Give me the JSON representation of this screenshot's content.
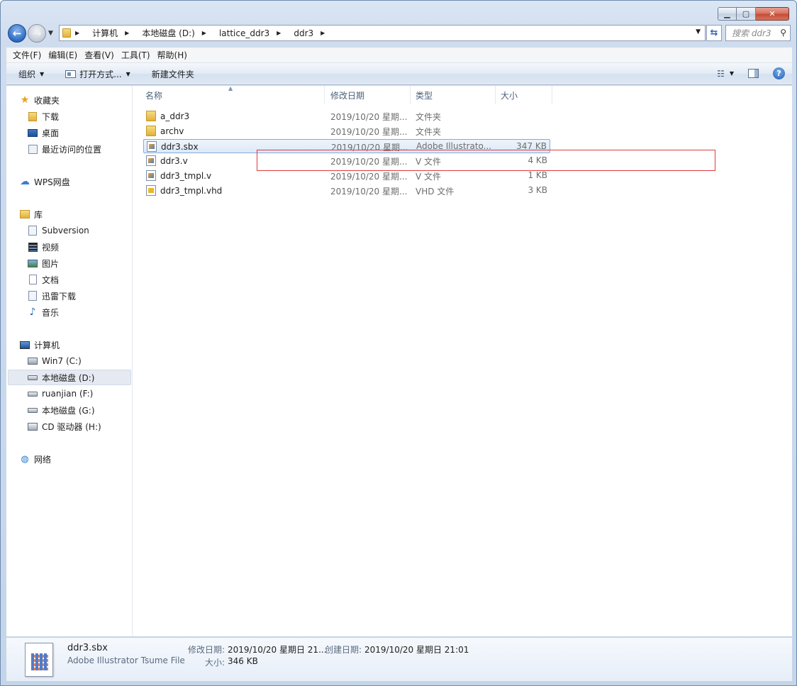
{
  "nav": {
    "breadcrumbs": [
      "计算机",
      "本地磁盘 (D:)",
      "lattice_ddr3",
      "ddr3"
    ],
    "search_placeholder": "搜索 ddr3"
  },
  "menu": [
    "文件(F)",
    "编辑(E)",
    "查看(V)",
    "工具(T)",
    "帮助(H)"
  ],
  "toolbar": {
    "organize": "组织",
    "open_with": "打开方式...",
    "new_folder": "新建文件夹"
  },
  "sidebar": {
    "favorites": {
      "label": "收藏夹",
      "items": [
        "下载",
        "桌面",
        "最近访问的位置"
      ]
    },
    "wps": "WPS网盘",
    "libraries": {
      "label": "库",
      "items": [
        "Subversion",
        "视频",
        "图片",
        "文档",
        "迅雷下载",
        "音乐"
      ]
    },
    "computer": {
      "label": "计算机",
      "items": [
        "Win7 (C:)",
        "本地磁盘 (D:)",
        "ruanjian (F:)",
        "本地磁盘 (G:)",
        "CD 驱动器 (H:)"
      ]
    },
    "network": "网络"
  },
  "columns": {
    "name": "名称",
    "modified": "修改日期",
    "type": "类型",
    "size": "大小"
  },
  "files": [
    {
      "name": "a_ddr3",
      "modified": "2019/10/20 星期...",
      "type": "文件夹",
      "size": "",
      "icon": "folder-icon"
    },
    {
      "name": "archv",
      "modified": "2019/10/20 星期...",
      "type": "文件夹",
      "size": "",
      "icon": "folder-icon"
    },
    {
      "name": "ddr3.sbx",
      "modified": "2019/10/20 星期...",
      "type": "Adobe Illustrato...",
      "size": "347 KB",
      "icon": "sbx-file-icon",
      "selected": true
    },
    {
      "name": "ddr3.v",
      "modified": "2019/10/20 星期...",
      "type": "V 文件",
      "size": "4 KB",
      "icon": "verilog-file-icon",
      "highlighted": true
    },
    {
      "name": "ddr3_tmpl.v",
      "modified": "2019/10/20 星期...",
      "type": "V 文件",
      "size": "1 KB",
      "icon": "verilog-file-icon"
    },
    {
      "name": "ddr3_tmpl.vhd",
      "modified": "2019/10/20 星期...",
      "type": "VHD 文件",
      "size": "3 KB",
      "icon": "vhd-file-icon"
    }
  ],
  "details": {
    "filename": "ddr3.sbx",
    "filetype": "Adobe Illustrator Tsume File",
    "modified_label": "修改日期:",
    "modified_value": "2019/10/20 星期日 21...",
    "created_label": "创建日期:",
    "created_value": "2019/10/20 星期日 21:01",
    "size_label": "大小:",
    "size_value": "346 KB"
  }
}
